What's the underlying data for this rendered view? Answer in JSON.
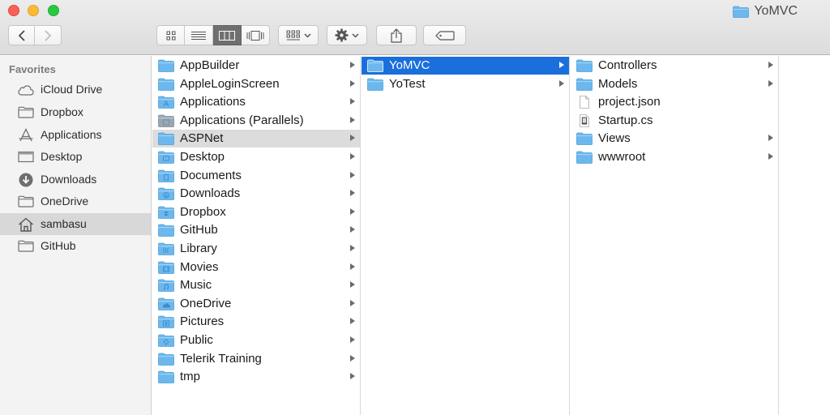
{
  "window": {
    "title": "YoMVC",
    "colors": {
      "folder": "#6cb8ee",
      "selection_blue": "#1a6fdc",
      "selection_gray": "#dcdcdc"
    }
  },
  "toolbar": {
    "back_icon": "chevron-left-icon",
    "forward_icon": "chevron-right-icon",
    "views": [
      "icon-view",
      "list-view",
      "column-view",
      "cover-flow-view"
    ],
    "active_view": "column-view",
    "arrange_icon": "arrange-grid-icon",
    "action_icon": "gear-icon",
    "share_icon": "share-icon",
    "tag_icon": "tag-icon"
  },
  "sidebar": {
    "header": "Favorites",
    "items": [
      {
        "label": "iCloud Drive",
        "icon": "cloud-icon"
      },
      {
        "label": "Dropbox",
        "icon": "folder-icon"
      },
      {
        "label": "Applications",
        "icon": "applications-icon"
      },
      {
        "label": "Desktop",
        "icon": "desktop-icon"
      },
      {
        "label": "Downloads",
        "icon": "download-icon"
      },
      {
        "label": "OneDrive",
        "icon": "folder-icon"
      },
      {
        "label": "sambasu",
        "icon": "home-icon",
        "selected": true
      },
      {
        "label": "GitHub",
        "icon": "folder-icon"
      }
    ]
  },
  "columns": {
    "home": [
      {
        "label": "AppBuilder",
        "icon": "folder-icon"
      },
      {
        "label": "AppleLoginScreen",
        "icon": "folder-icon"
      },
      {
        "label": "Applications",
        "icon": "applications-folder-icon"
      },
      {
        "label": "Applications (Parallels)",
        "icon": "parallels-folder-icon"
      },
      {
        "label": "ASPNet",
        "icon": "folder-icon",
        "selected": "gray"
      },
      {
        "label": "Desktop",
        "icon": "desktop-folder-icon"
      },
      {
        "label": "Documents",
        "icon": "documents-folder-icon"
      },
      {
        "label": "Downloads",
        "icon": "downloads-folder-icon"
      },
      {
        "label": "Dropbox",
        "icon": "dropbox-folder-icon"
      },
      {
        "label": "GitHub",
        "icon": "folder-icon"
      },
      {
        "label": "Library",
        "icon": "library-folder-icon"
      },
      {
        "label": "Movies",
        "icon": "movies-folder-icon"
      },
      {
        "label": "Music",
        "icon": "music-folder-icon"
      },
      {
        "label": "OneDrive",
        "icon": "onedrive-folder-icon"
      },
      {
        "label": "Pictures",
        "icon": "pictures-folder-icon"
      },
      {
        "label": "Public",
        "icon": "public-folder-icon"
      },
      {
        "label": "Telerik Training",
        "icon": "folder-icon"
      },
      {
        "label": "tmp",
        "icon": "folder-icon"
      }
    ],
    "aspnet": [
      {
        "label": "YoMVC",
        "icon": "folder-icon",
        "selected": "blue"
      },
      {
        "label": "YoTest",
        "icon": "folder-icon"
      }
    ],
    "yomvc": [
      {
        "label": "Controllers",
        "icon": "folder-icon",
        "folder": true
      },
      {
        "label": "Models",
        "icon": "folder-icon",
        "folder": true
      },
      {
        "label": "project.json",
        "icon": "document-icon",
        "folder": false
      },
      {
        "label": "Startup.cs",
        "icon": "cs-file-icon",
        "folder": false
      },
      {
        "label": "Views",
        "icon": "folder-icon",
        "folder": true
      },
      {
        "label": "wwwroot",
        "icon": "folder-icon",
        "folder": true
      }
    ]
  }
}
